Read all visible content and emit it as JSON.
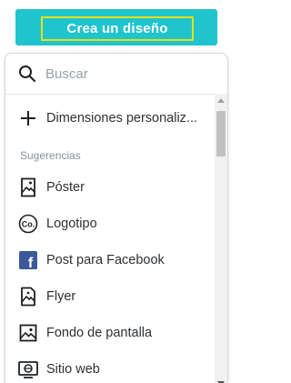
{
  "create_button": {
    "label": "Crea un diseño"
  },
  "search": {
    "placeholder": "Buscar",
    "value": ""
  },
  "custom_dimensions": {
    "label": "Dimensiones personaliz..."
  },
  "suggestions": {
    "section_label": "Sugerencias",
    "items": [
      {
        "label": "Póster",
        "icon": "poster-icon"
      },
      {
        "label": "Logotipo",
        "icon": "logo-icon",
        "icon_text": "Co."
      },
      {
        "label": "Post para Facebook",
        "icon": "facebook-icon",
        "icon_text": "f"
      },
      {
        "label": "Flyer",
        "icon": "flyer-icon"
      },
      {
        "label": "Fondo de pantalla",
        "icon": "wallpaper-icon"
      },
      {
        "label": "Sitio web",
        "icon": "website-icon"
      }
    ]
  },
  "colors": {
    "accent": "#1fc4cc",
    "focus_outline": "#e4e01c",
    "facebook": "#3b5998"
  }
}
